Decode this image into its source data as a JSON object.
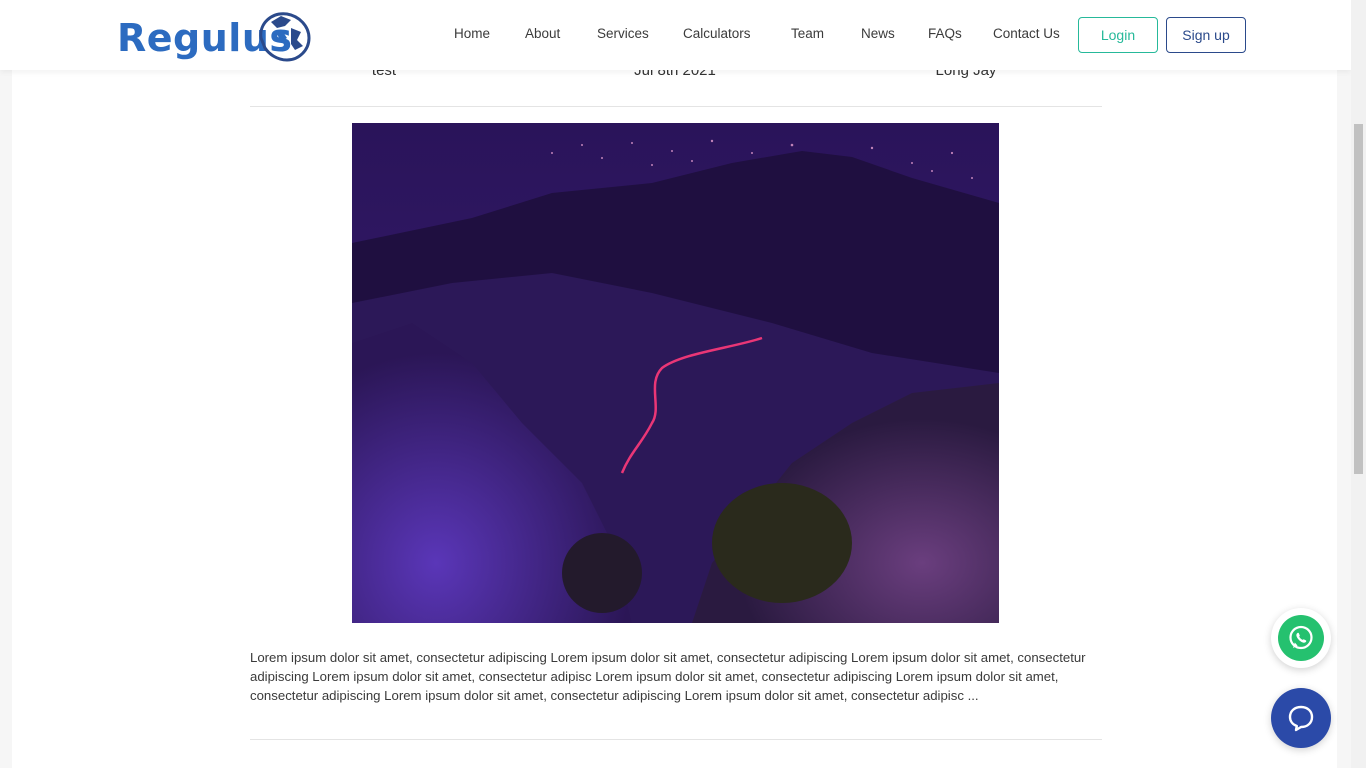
{
  "brand": {
    "name": "Regulus",
    "logo_color": "#2c6bc0"
  },
  "nav": {
    "items": [
      {
        "label": "Home"
      },
      {
        "label": "About"
      },
      {
        "label": "Services"
      },
      {
        "label": "Calculators"
      },
      {
        "label": "Team"
      },
      {
        "label": "News"
      },
      {
        "label": "FAQs"
      },
      {
        "label": "Contact Us"
      }
    ],
    "login_label": "Login",
    "signup_label": "Sign up"
  },
  "article": {
    "title": "test",
    "date": "Jul 8th 2021",
    "author": "Long Jay",
    "excerpt": "Lorem ipsum dolor sit amet, consectetur adipiscing Lorem ipsum dolor sit amet, consectetur adipiscing Lorem ipsum dolor sit amet, consectetur adipiscing Lorem ipsum dolor sit amet, consectetur adipisc Lorem ipsum dolor sit amet, consectetur adipiscing Lorem ipsum dolor sit amet, consectetur adipiscing Lorem ipsum dolor sit amet, consectetur adipiscing Lorem ipsum dolor sit amet, consectetur adipisc ..."
  },
  "icons": {
    "whatsapp": "whatsapp-icon",
    "chat": "chat-bubble-icon",
    "logo": "lion-head-icon"
  },
  "colors": {
    "accent_green": "#26b99a",
    "accent_navy": "#2b4a8b",
    "whatsapp_green": "#25c16f",
    "chat_blue": "#2b4aa8"
  }
}
